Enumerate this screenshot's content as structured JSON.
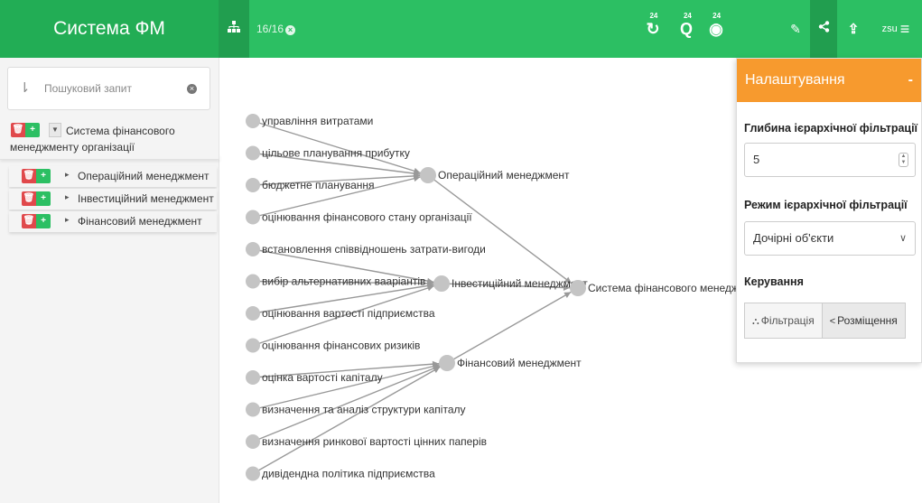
{
  "topbar": {
    "brand": "Система ФМ",
    "counter": "16/16",
    "sup_badge": "24",
    "user": "zsu"
  },
  "search": {
    "placeholder": "Пошуковий запит"
  },
  "tree": {
    "root_line1": "Система фінансового",
    "root_line2": "менеджменту організації",
    "children": [
      "Операційний менеджмент",
      "Інвестиційний менеджмент",
      "Фінансовий менеджмент"
    ]
  },
  "graph": {
    "leaves": [
      "управління витратами",
      "цільове планування прибутку",
      "бюджетне планування",
      "оцінювання фінансового стану організації",
      "встановлення співвідношень затрати-вигоди",
      "вибір альтернативних ваарiантів",
      "оцінювання вартості підприємства",
      "оцінювання фінансових ризиків",
      "оцінка вартості капіталу",
      "визначення та аналіз структури капіталу",
      "визначення ринкової вартості цінних паперів",
      "дивідендна політика підприємства"
    ],
    "mids": [
      "Операційний менеджмент",
      "Інвестиційний менеджмент",
      "Фінансовий менеджмент"
    ],
    "root": "Система фінансового менеджменту організації",
    "node_color": "#c4c4c4",
    "edge_color": "#999999"
  },
  "settings": {
    "title": "Налаштування",
    "minimize": "-",
    "depth_label": "Глибина ієрархічної фільтрації",
    "depth_value": "5",
    "mode_label": "Режим ієрархічної фільтрації",
    "mode_value": "Дочірні об'єкти",
    "control_label": "Керування",
    "filter_button": "Фільтрація",
    "layout_button": "Розміщення"
  },
  "colors": {
    "topbar": "#2cbf63",
    "brand": "#22ad55",
    "settings_header": "#f79a2e",
    "delete": "#e0484b"
  },
  "icons": [
    "hierarchy-icon",
    "close-circle-icon",
    "refresh-icon",
    "search-icon",
    "eye-icon",
    "edit-icon",
    "share-icon",
    "upload-icon",
    "menu-icon",
    "sort-icon",
    "trash-icon",
    "plus-icon",
    "caret-icon"
  ]
}
